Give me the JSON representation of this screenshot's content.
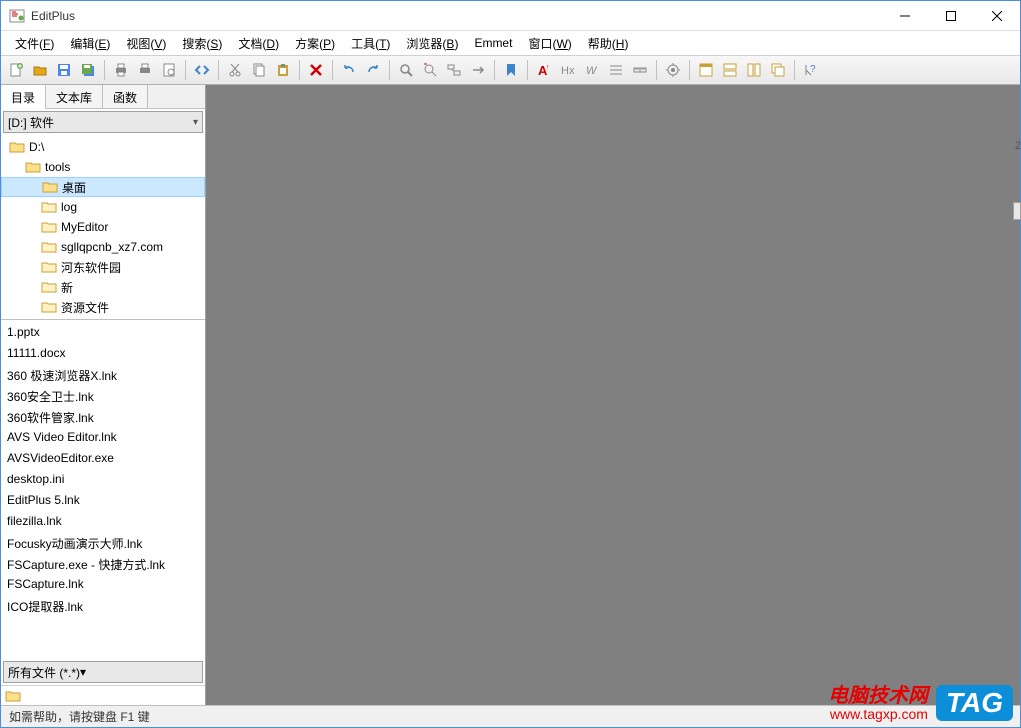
{
  "title": "EditPlus",
  "menubar": [
    {
      "label": "文件",
      "key": "F"
    },
    {
      "label": "编辑",
      "key": "E"
    },
    {
      "label": "视图",
      "key": "V"
    },
    {
      "label": "搜索",
      "key": "S"
    },
    {
      "label": "文档",
      "key": "D"
    },
    {
      "label": "方案",
      "key": "P"
    },
    {
      "label": "工具",
      "key": "T"
    },
    {
      "label": "浏览器",
      "key": "B"
    },
    {
      "label": "Emmet",
      "key": ""
    },
    {
      "label": "窗口",
      "key": "W"
    },
    {
      "label": "帮助",
      "key": "H"
    }
  ],
  "side_tabs": {
    "t0": "目录",
    "t1": "文本库",
    "t2": "函数"
  },
  "drive_selected": "[D:] 软件",
  "tree": [
    {
      "label": "D:\\",
      "indent": 0,
      "sel": false
    },
    {
      "label": "tools",
      "indent": 1,
      "sel": false
    },
    {
      "label": "桌面",
      "indent": 2,
      "sel": true
    },
    {
      "label": "log",
      "indent": 2,
      "sel": false
    },
    {
      "label": "MyEditor",
      "indent": 2,
      "sel": false
    },
    {
      "label": "sgllqpcnb_xz7.com",
      "indent": 2,
      "sel": false
    },
    {
      "label": "河东软件园",
      "indent": 2,
      "sel": false
    },
    {
      "label": "新",
      "indent": 2,
      "sel": false
    },
    {
      "label": "资源文件",
      "indent": 2,
      "sel": false
    }
  ],
  "files": [
    "1.pptx",
    "11111.docx",
    "360 极速浏览器X.lnk",
    "360安全卫士.lnk",
    "360软件管家.lnk",
    "AVS Video Editor.lnk",
    "AVSVideoEditor.exe",
    "desktop.ini",
    "EditPlus 5.lnk",
    "filezilla.lnk",
    "Focusky动画演示大师.lnk",
    "FSCapture.exe - 快捷方式.lnk",
    "FSCapture.lnk",
    "ICO提取器.lnk"
  ],
  "file_filter": "所有文件 (*.*)",
  "status_text": "如需帮助，请按键盘 F1 键",
  "watermark": {
    "cn": "电脑技术网",
    "url": "www.tagxp.com",
    "tag": "TAG"
  },
  "toolbar_icons": [
    "new-file-icon",
    "open-icon",
    "save-icon",
    "save-all-icon",
    "sep",
    "print-icon",
    "printer-icon",
    "preview-icon",
    "sep",
    "html-icon",
    "sep",
    "cut-icon",
    "copy-icon",
    "paste-icon",
    "sep",
    "delete-icon",
    "sep",
    "undo-icon",
    "redo-icon",
    "sep",
    "find-icon",
    "find-prev-icon",
    "replace-icon",
    "goto-icon",
    "sep",
    "bookmark-icon",
    "sep",
    "font-increase-icon",
    "heading-icon",
    "word-wrap-icon",
    "line-number-icon",
    "ruler-icon",
    "sep",
    "settings-icon",
    "sep",
    "window-icon",
    "tile-h-icon",
    "tile-v-icon",
    "cascade-icon",
    "sep",
    "help-icon"
  ],
  "icon_colors": {
    "new-file-icon": "#6aa84f",
    "open-icon": "#e6a817",
    "save-icon": "#4a86e8",
    "save-all-icon": "#4a86e8",
    "print-icon": "#888",
    "printer-icon": "#888",
    "preview-icon": "#888",
    "html-icon": "#3d85c6",
    "cut-icon": "#888",
    "copy-icon": "#888",
    "paste-icon": "#c9a03a",
    "delete-icon": "#cc0000",
    "undo-icon": "#3d85c6",
    "redo-icon": "#3d85c6",
    "find-icon": "#888",
    "find-prev-icon": "#888",
    "replace-icon": "#888",
    "goto-icon": "#888",
    "bookmark-icon": "#3d85c6",
    "font-increase-icon": "#cc0000",
    "heading-icon": "#888",
    "word-wrap-icon": "#888",
    "line-number-icon": "#888",
    "ruler-icon": "#888",
    "settings-icon": "#888",
    "window-icon": "#c9a03a",
    "tile-h-icon": "#c9a03a",
    "tile-v-icon": "#c9a03a",
    "cascade-icon": "#c9a03a",
    "help-icon": "#3d85c6"
  }
}
